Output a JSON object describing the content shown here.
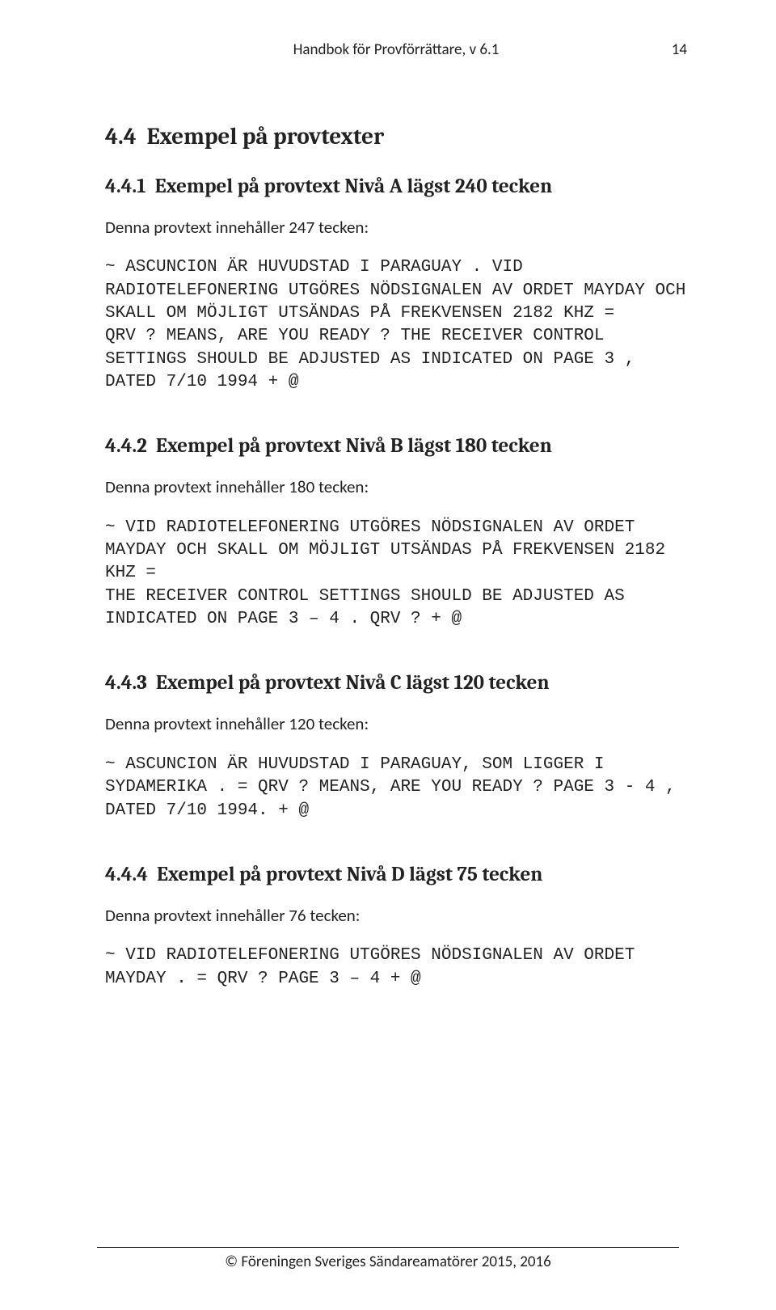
{
  "header": {
    "running_title": "Handbok för Provförrättare, v 6.1",
    "page_number": "14"
  },
  "section": {
    "number": "4.4",
    "title": "Exempel på provtexter"
  },
  "subsections": [
    {
      "number": "4.4.1",
      "title": "Exempel på provtext Nivå A lägst 240 tecken",
      "intro": "Denna provtext innehåller 247 tecken:",
      "mono": "~ ASCUNCION ÄR HUVUDSTAD I PARAGUAY . VID RADIOTELEFONERING UTGÖRES NÖDSIGNALEN AV ORDET MAYDAY OCH SKALL OM MÖJLIGT UTSÄNDAS PÅ FREKVENSEN 2182 KHZ =\nQRV ? MEANS, ARE YOU READY ? THE RECEIVER CONTROL SETTINGS SHOULD BE ADJUSTED AS INDICATED ON PAGE 3 , DATED 7/10 1994 + @"
    },
    {
      "number": "4.4.2",
      "title": "Exempel på provtext Nivå B lägst 180 tecken",
      "intro": "Denna provtext innehåller 180 tecken:",
      "mono": "~ VID RADIOTELEFONERING UTGÖRES NÖDSIGNALEN AV ORDET MAYDAY OCH SKALL OM MÖJLIGT UTSÄNDAS PÅ FREKVENSEN 2182 KHZ =\nTHE RECEIVER CONTROL SETTINGS SHOULD BE ADJUSTED AS INDICATED ON PAGE 3 – 4 . QRV ? + @"
    },
    {
      "number": "4.4.3",
      "title": "Exempel på provtext Nivå C lägst 120 tecken",
      "intro": "Denna provtext innehåller 120 tecken:",
      "mono": "~ ASCUNCION ÄR HUVUDSTAD I PARAGUAY, SOM LIGGER I SYDAMERIKA . = QRV ? MEANS, ARE YOU READY ? PAGE 3 - 4 , DATED 7/10 1994. + @"
    },
    {
      "number": "4.4.4",
      "title": "Exempel på provtext Nivå D lägst 75 tecken",
      "intro": "Denna provtext innehåller 76 tecken:",
      "mono": "~ VID RADIOTELEFONERING UTGÖRES NÖDSIGNALEN AV ORDET MAYDAY . = QRV ? PAGE 3 – 4 + @"
    }
  ],
  "footer": {
    "text": "© Föreningen Sveriges Sändareamatörer 2015, 2016"
  }
}
